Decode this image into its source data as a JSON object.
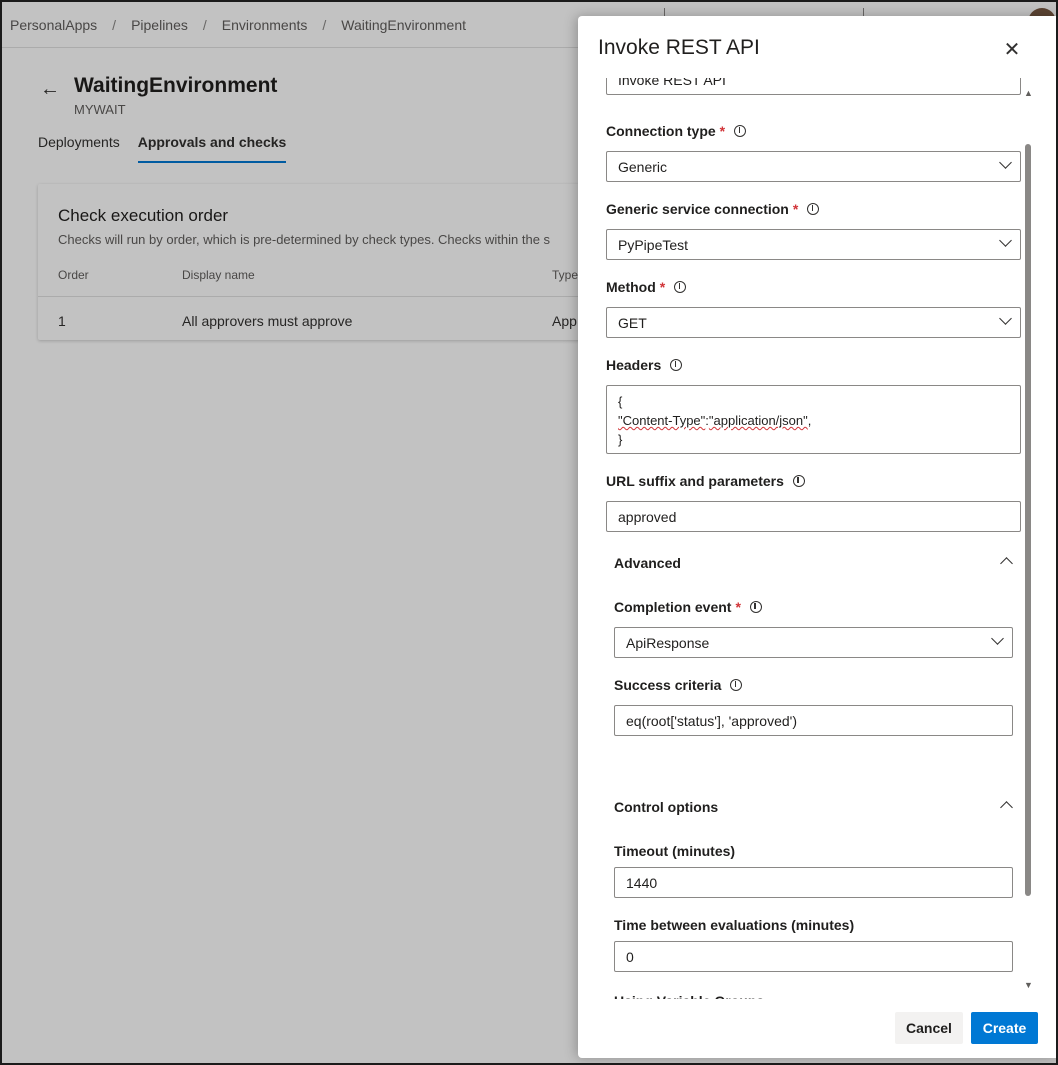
{
  "breadcrumb": [
    "PersonalApps",
    "Pipelines",
    "Environments",
    "WaitingEnvironment"
  ],
  "environment": {
    "title": "WaitingEnvironment",
    "subtitle": "MYWAIT"
  },
  "tabs": [
    "Deployments",
    "Approvals and checks"
  ],
  "checks_card": {
    "title": "Check execution order",
    "description": "Checks will run by order, which is pre-determined by check types. Checks within the s",
    "columns": [
      "Order",
      "Display name",
      "Type"
    ],
    "rows": [
      {
        "order": "1",
        "name": "All approvers must approve",
        "type": "App"
      }
    ]
  },
  "panel": {
    "title": "Invoke REST API",
    "display_name_value": "Invoke REST API",
    "connection_type": {
      "label": "Connection type",
      "value": "Generic"
    },
    "service_connection": {
      "label": "Generic service connection",
      "value": "PyPipeTest"
    },
    "method": {
      "label": "Method",
      "value": "GET"
    },
    "headers": {
      "label": "Headers",
      "line1": "{",
      "line2_key": "\"Content-Type\"",
      "line2_colon": ":",
      "line2_value": "\"application/json\"",
      "line2_end": ",",
      "line3": "}"
    },
    "url_suffix": {
      "label": "URL suffix and parameters",
      "value": "approved"
    },
    "advanced": {
      "label": "Advanced",
      "completion_event": {
        "label": "Completion event",
        "value": "ApiResponse"
      },
      "success_criteria": {
        "label": "Success criteria",
        "value": "eq(root['status'], 'approved')"
      }
    },
    "control_options": {
      "label": "Control options",
      "timeout": {
        "label": "Timeout (minutes)",
        "value": "1440"
      },
      "time_between": {
        "label": "Time between evaluations (minutes)",
        "value": "0"
      },
      "next_label": "Using Variable Groups"
    },
    "cancel_label": "Cancel",
    "create_label": "Create"
  }
}
